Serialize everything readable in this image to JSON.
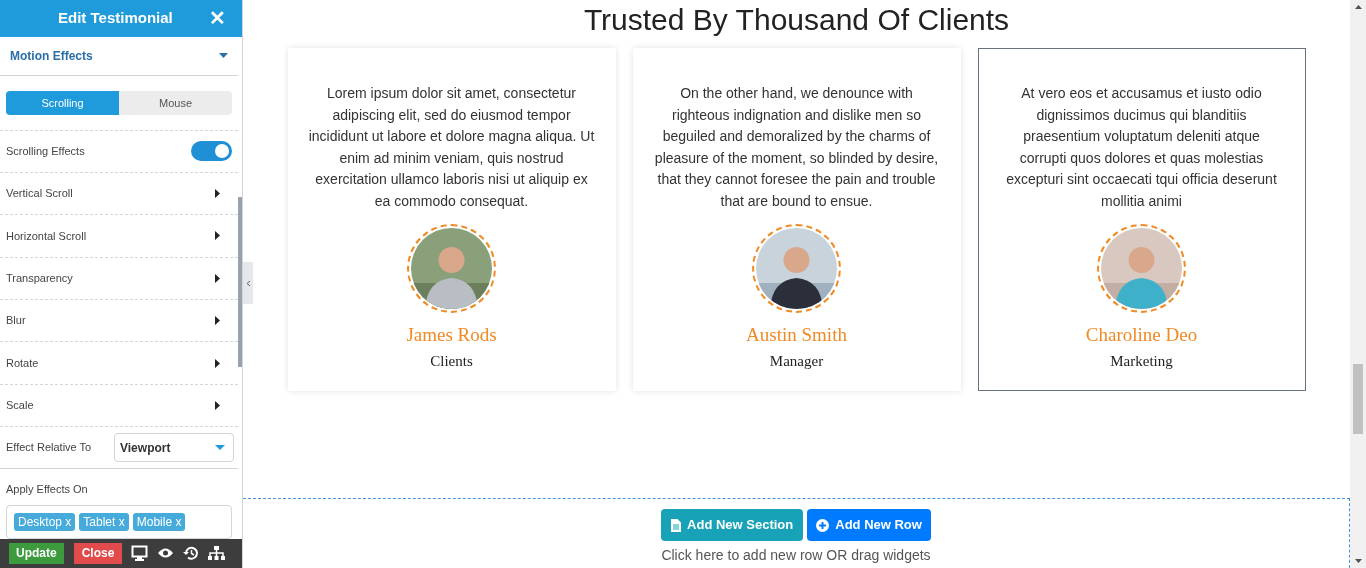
{
  "panel": {
    "title": "Edit Testimonial",
    "close": "✕",
    "section": {
      "label": "Motion Effects",
      "expanded": true
    },
    "tabs": [
      {
        "label": "Scrolling",
        "selected": true
      },
      {
        "label": "Mouse",
        "selected": false
      }
    ],
    "toggle": {
      "label": "Scrolling Effects",
      "on": true
    },
    "expanders": [
      "Vertical Scroll",
      "Horizontal Scroll",
      "Transparency",
      "Blur",
      "Rotate",
      "Scale"
    ],
    "relative": {
      "label": "Effect Relative To",
      "value": "Viewport"
    },
    "apply": {
      "label": "Apply Effects On",
      "tags": [
        "Desktop x",
        "Tablet x",
        "Mobile x"
      ]
    },
    "footer": {
      "update": "Update",
      "close": "Close"
    }
  },
  "heading": "Trusted By Thousand Of Clients",
  "testimonials": [
    {
      "text": "Lorem ipsum dolor sit amet, consectetur adipiscing elit, sed do eiusmod tempor incididunt ut labore et dolore magna aliqua. Ut enim ad minim veniam, quis nostrud exercitation ullamco laboris nisi ut aliquip ex ea commodo consequat.",
      "name": "James Rods",
      "role": "Clients",
      "selected": false
    },
    {
      "text": "On the other hand, we denounce with righteous indignation and dislike men so beguiled and demoralized by the charms of pleasure of the moment, so blinded by desire, that they cannot foresee the pain and trouble that are bound to ensue.",
      "name": "Austin Smith",
      "role": "Manager",
      "selected": false
    },
    {
      "text": "At vero eos et accusamus et iusto odio dignissimos ducimus qui blanditiis praesentium voluptatum deleniti atque corrupti quos dolores et quas molestias excepturi sint occaecati tqui officia deserunt mollitia animi",
      "name": "Charoline Deo",
      "role": "Marketing",
      "selected": true
    }
  ],
  "add": {
    "section": "Add New Section",
    "row": "Add New Row",
    "hint": "Click here to add new row OR drag widgets"
  }
}
